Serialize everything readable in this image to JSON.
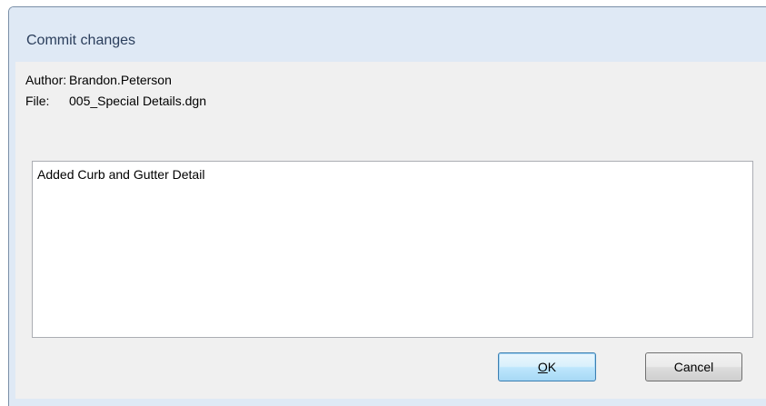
{
  "dialog": {
    "title": "Commit changes",
    "author_label": "Author:",
    "author_value": "Brandon.Peterson",
    "file_label": "File:",
    "file_value": "005_Special Details.dgn",
    "message": "Added Curb and Gutter Detail",
    "ok_mnemonic": "O",
    "ok_rest": "K",
    "cancel_label": "Cancel"
  },
  "colors": {
    "titlebar": "#dfe9f5",
    "title_text": "#2b3e5c",
    "client": "#f0f0f0",
    "default_button_border": "#3c7fb1"
  }
}
